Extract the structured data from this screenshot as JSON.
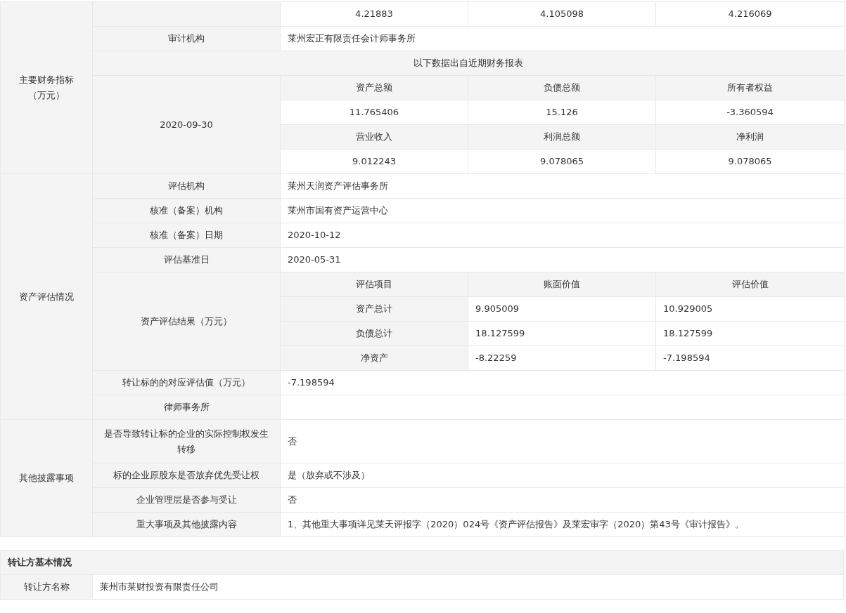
{
  "sections": [
    {
      "title": "主要财务指标（万元）",
      "rows": [
        {
          "kind": "values",
          "cells": [
            "4.21883",
            "4.105098",
            "4.216069"
          ]
        },
        {
          "kind": "field",
          "label": "审计机构",
          "value": "莱州宏正有限责任会计师事务所"
        },
        {
          "kind": "banner",
          "text": "以下数据出自近期财务报表"
        },
        {
          "kind": "grid",
          "label": "2020-09-30",
          "blocks": [
            {
              "headers": [
                "资产总额",
                "负债总额",
                "所有者权益"
              ],
              "values": [
                "11.765406",
                "15.126",
                "-3.360594"
              ]
            },
            {
              "headers": [
                "营业收入",
                "利润总额",
                "净利润"
              ],
              "values": [
                "9.012243",
                "9.078065",
                "9.078065"
              ]
            }
          ]
        }
      ]
    },
    {
      "title": "资产评估情况",
      "rows": [
        {
          "kind": "field",
          "label": "评估机构",
          "value": "莱州天润资产评估事务所"
        },
        {
          "kind": "field",
          "label": "核准（备案）机构",
          "value": "莱州市国有资产运营中心"
        },
        {
          "kind": "field",
          "label": "核准（备案）日期",
          "value": "2020-10-12"
        },
        {
          "kind": "field",
          "label": "评估基准日",
          "value": "2020-05-31"
        },
        {
          "kind": "table",
          "label": "资产评估结果（万元）",
          "columns": [
            "评估项目",
            "账面价值",
            "评估价值"
          ],
          "rows": [
            [
              "资产总计",
              "9.905009",
              "10.929005"
            ],
            [
              "负债总计",
              "18.127599",
              "18.127599"
            ],
            [
              "净资产",
              "-8.22259",
              "-7.198594"
            ]
          ]
        },
        {
          "kind": "field",
          "label": "转让标的的对应评估值（万元）",
          "value": "-7.198594"
        },
        {
          "kind": "field",
          "label": "律师事务所"
        }
      ]
    },
    {
      "title": "其他披露事项",
      "rows": [
        {
          "kind": "field",
          "label": "是否导致转让标的企业的实际控制权发生转移",
          "value": "否"
        },
        {
          "kind": "field",
          "label": "标的企业原股东是否放弃优先受让权",
          "value": "是（放弃或不涉及）"
        },
        {
          "kind": "field",
          "label": "企业管理层是否参与受让",
          "value": "否"
        },
        {
          "kind": "field",
          "label": "重大事项及其他披露内容",
          "value": "1、其他重大事项详见莱天评报字（2020）024号《资产评估报告》及莱宏审字（2020）第43号《审计报告》。"
        }
      ]
    }
  ],
  "transferor": {
    "title": "转让方基本情况",
    "rows": [
      {
        "label": "转让方名称",
        "value": "莱州市莱财投资有限责任公司"
      }
    ]
  }
}
